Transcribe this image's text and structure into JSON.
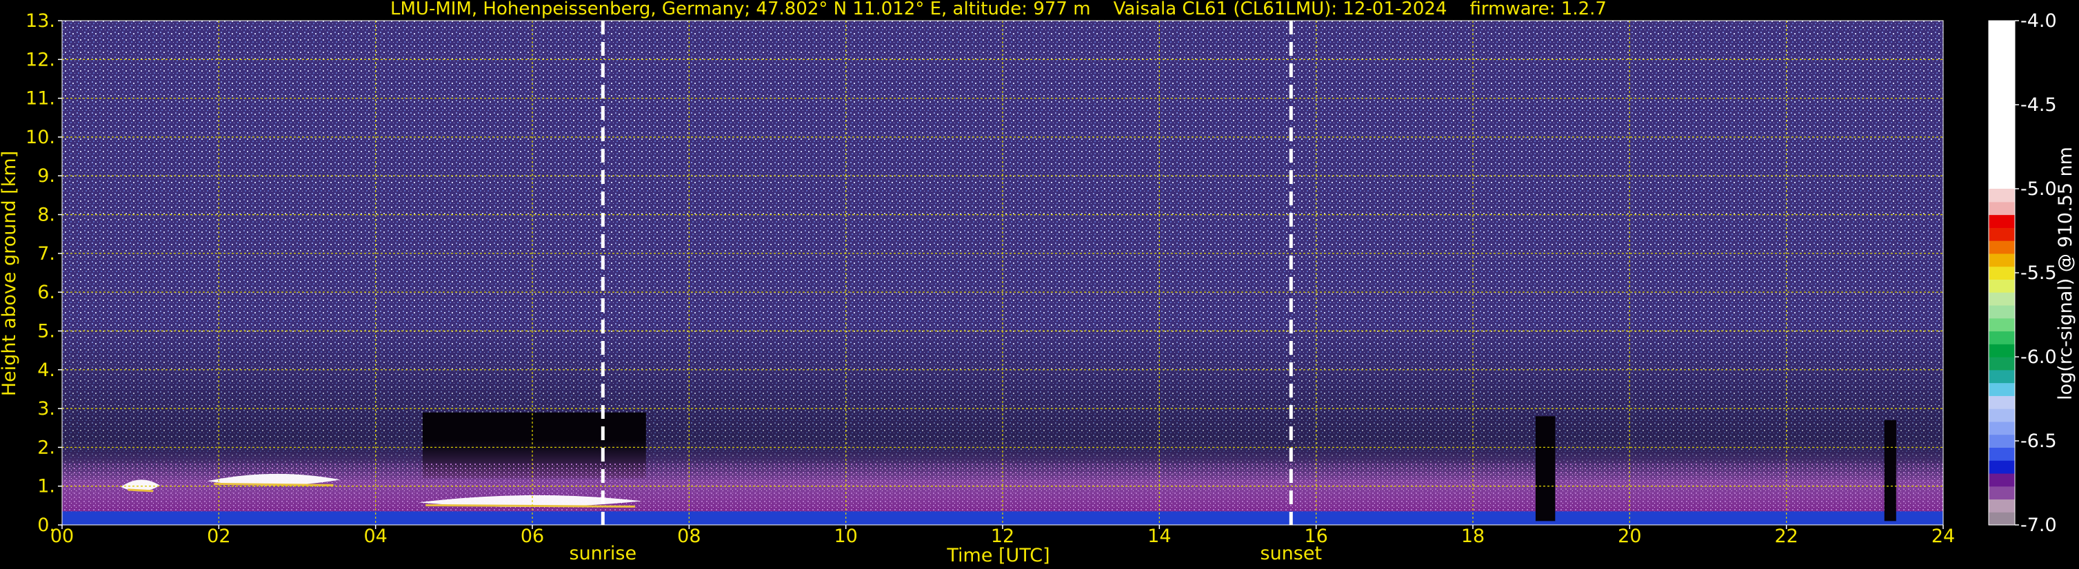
{
  "chart_data": {
    "type": "heatmap",
    "title": "LMU-MIM, Hohenpeissenberg, Germany; 47.802° N 11.012° E, altitude: 977 m    Vaisala CL61 (CL61LMU): 12-01-2024    firmware: 1.2.7",
    "xlabel": "Time [UTC]",
    "ylabel": "Height above ground [km]",
    "colorbar_label": "log(rc-signal) @ 910.55 nm",
    "xlim": [
      0,
      24
    ],
    "ylim": [
      0,
      13
    ],
    "x_ticks": [
      "00",
      "02",
      "04",
      "06",
      "08",
      "10",
      "12",
      "14",
      "16",
      "18",
      "20",
      "22",
      "24"
    ],
    "y_ticks": [
      "0.",
      "1.",
      "2.",
      "3.",
      "4.",
      "5.",
      "6.",
      "7.",
      "8.",
      "9.",
      "10.",
      "11.",
      "12.",
      "13."
    ],
    "colorbar_ticks": [
      "-4.0",
      "-4.5",
      "-5.0",
      "-5.5",
      "-6.0",
      "-6.5",
      "-7.0"
    ],
    "colorbar_range": [
      -7.0,
      -4.0
    ],
    "grid": true,
    "annotations": [
      {
        "label": "sunrise",
        "time": 6.9
      },
      {
        "label": "sunset",
        "time": 15.68
      }
    ],
    "cloud_layers": [
      {
        "t0": 0.75,
        "t1": 1.25,
        "height": 1.05
      },
      {
        "t0": 1.85,
        "t1": 3.55,
        "height": 1.2
      },
      {
        "t0": 4.55,
        "t1": 7.4,
        "height": 0.65
      }
    ],
    "signal_gaps": [
      {
        "t0": 4.6,
        "t1": 7.45,
        "h0": 1.2,
        "h1": 2.9
      },
      {
        "t0": 18.8,
        "t1": 19.05,
        "h0": 0.1,
        "h1": 2.8
      },
      {
        "t0": 23.25,
        "t1": 23.4,
        "h0": 0.1,
        "h1": 2.7
      }
    ],
    "colors": {
      "axis_text": "#f5e600",
      "grid": "#d8cc00",
      "background": "#000000",
      "noise": "#3d2f7a",
      "boundary_layer": "#7a1a8a",
      "surface_layer": "#2040d0"
    }
  }
}
